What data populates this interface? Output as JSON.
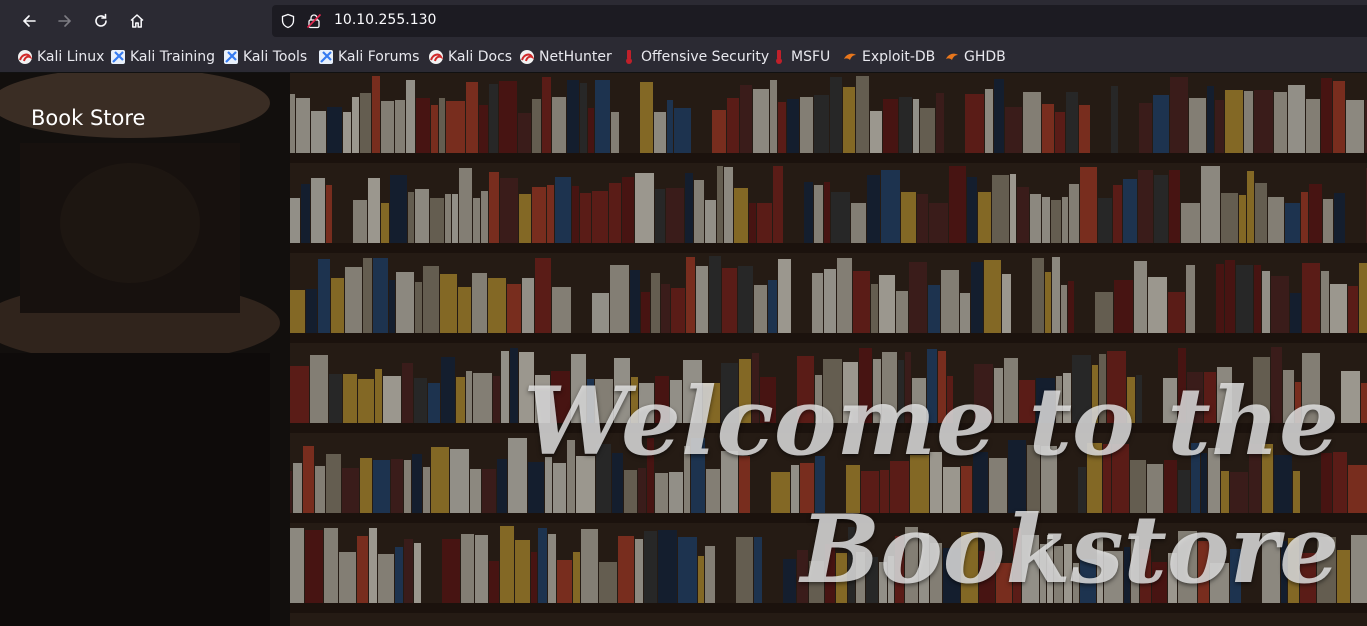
{
  "browser": {
    "url": "10.10.255.130",
    "nav": [
      {
        "name": "back-button",
        "icon": "arrow-left-icon"
      },
      {
        "name": "forward-button",
        "icon": "arrow-right-icon"
      },
      {
        "name": "reload-button",
        "icon": "reload-icon"
      },
      {
        "name": "home-button",
        "icon": "home-icon"
      }
    ],
    "bookmarks": [
      {
        "label": "Kali Linux",
        "icon": "kali-dragon-icon"
      },
      {
        "label": "Kali Training",
        "icon": "kali-training-icon"
      },
      {
        "label": "Kali Tools",
        "icon": "kali-tools-icon"
      },
      {
        "label": "Kali Forums",
        "icon": "kali-forums-icon"
      },
      {
        "label": "Kali Docs",
        "icon": "kali-dragon-icon"
      },
      {
        "label": "NetHunter",
        "icon": "kali-dragon-icon"
      },
      {
        "label": "Offensive Security",
        "icon": "offsec-icon"
      },
      {
        "label": "MSFU",
        "icon": "offsec-icon"
      },
      {
        "label": "Exploit-DB",
        "icon": "exploit-db-icon"
      },
      {
        "label": "GHDB",
        "icon": "exploit-db-icon"
      }
    ]
  },
  "page": {
    "brand": "Book Store",
    "hero_line1": "Welcome to the",
    "hero_line2": "Bookstore"
  },
  "colors": {
    "toolbar_bg": "#2b2a33",
    "urlbar_bg": "#1c1b22",
    "kali_red": "#d02a2a",
    "kali_blue": "#367bf0",
    "exploit_orange": "#e8761c"
  }
}
